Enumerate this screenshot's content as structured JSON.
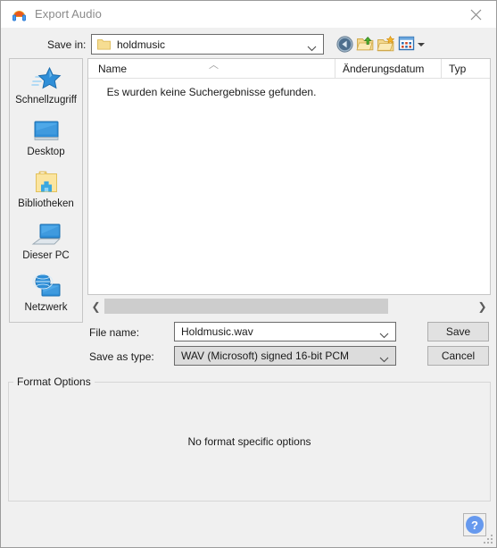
{
  "window": {
    "title": "Export Audio",
    "icon": "audacity-headphones-icon",
    "close_label": "✕"
  },
  "toolbar": {
    "save_in_label": "Save in:",
    "save_in_value": "holdmusic",
    "save_in_icon": "folder-icon",
    "buttons": [
      {
        "name": "back-button",
        "icon": "back-arrow-icon"
      },
      {
        "name": "up-one-level-button",
        "icon": "folder-up-icon"
      },
      {
        "name": "new-folder-button",
        "icon": "new-folder-icon"
      },
      {
        "name": "view-menu-button",
        "icon": "view-grid-icon"
      }
    ]
  },
  "places": {
    "items": [
      {
        "label": "Schnellzugriff",
        "icon": "star-icon"
      },
      {
        "label": "Desktop",
        "icon": "monitor-icon"
      },
      {
        "label": "Bibliotheken",
        "icon": "libraries-folder-icon"
      },
      {
        "label": "Dieser PC",
        "icon": "computer-icon"
      },
      {
        "label": "Netzwerk",
        "icon": "network-globe-icon"
      }
    ]
  },
  "filelist": {
    "columns": [
      {
        "label": "Name",
        "sorted": "ascending"
      },
      {
        "label": "Änderungsdatum"
      },
      {
        "label": "Typ"
      }
    ],
    "sort_caret": "︿",
    "empty_message": "Es wurden keine Suchergebnisse gefunden.",
    "rows": [],
    "scrollbar": {
      "left_arrow": "❮",
      "right_arrow": "❯"
    }
  },
  "form": {
    "file_name_label": "File name:",
    "file_name_value": "Holdmusic.wav",
    "save_as_type_label": "Save as type:",
    "save_as_type_value": "WAV (Microsoft) signed 16-bit PCM",
    "save_button": "Save",
    "cancel_button": "Cancel"
  },
  "format_options": {
    "title": "Format Options",
    "message": "No format specific options"
  },
  "help": {
    "label": "?"
  },
  "colors": {
    "dialog_bg": "#f0f0f0",
    "panel_bg": "#ffffff",
    "accent_help": "#6699ee",
    "title_text": "#8a8a8a",
    "border": "#c6c6c6"
  }
}
